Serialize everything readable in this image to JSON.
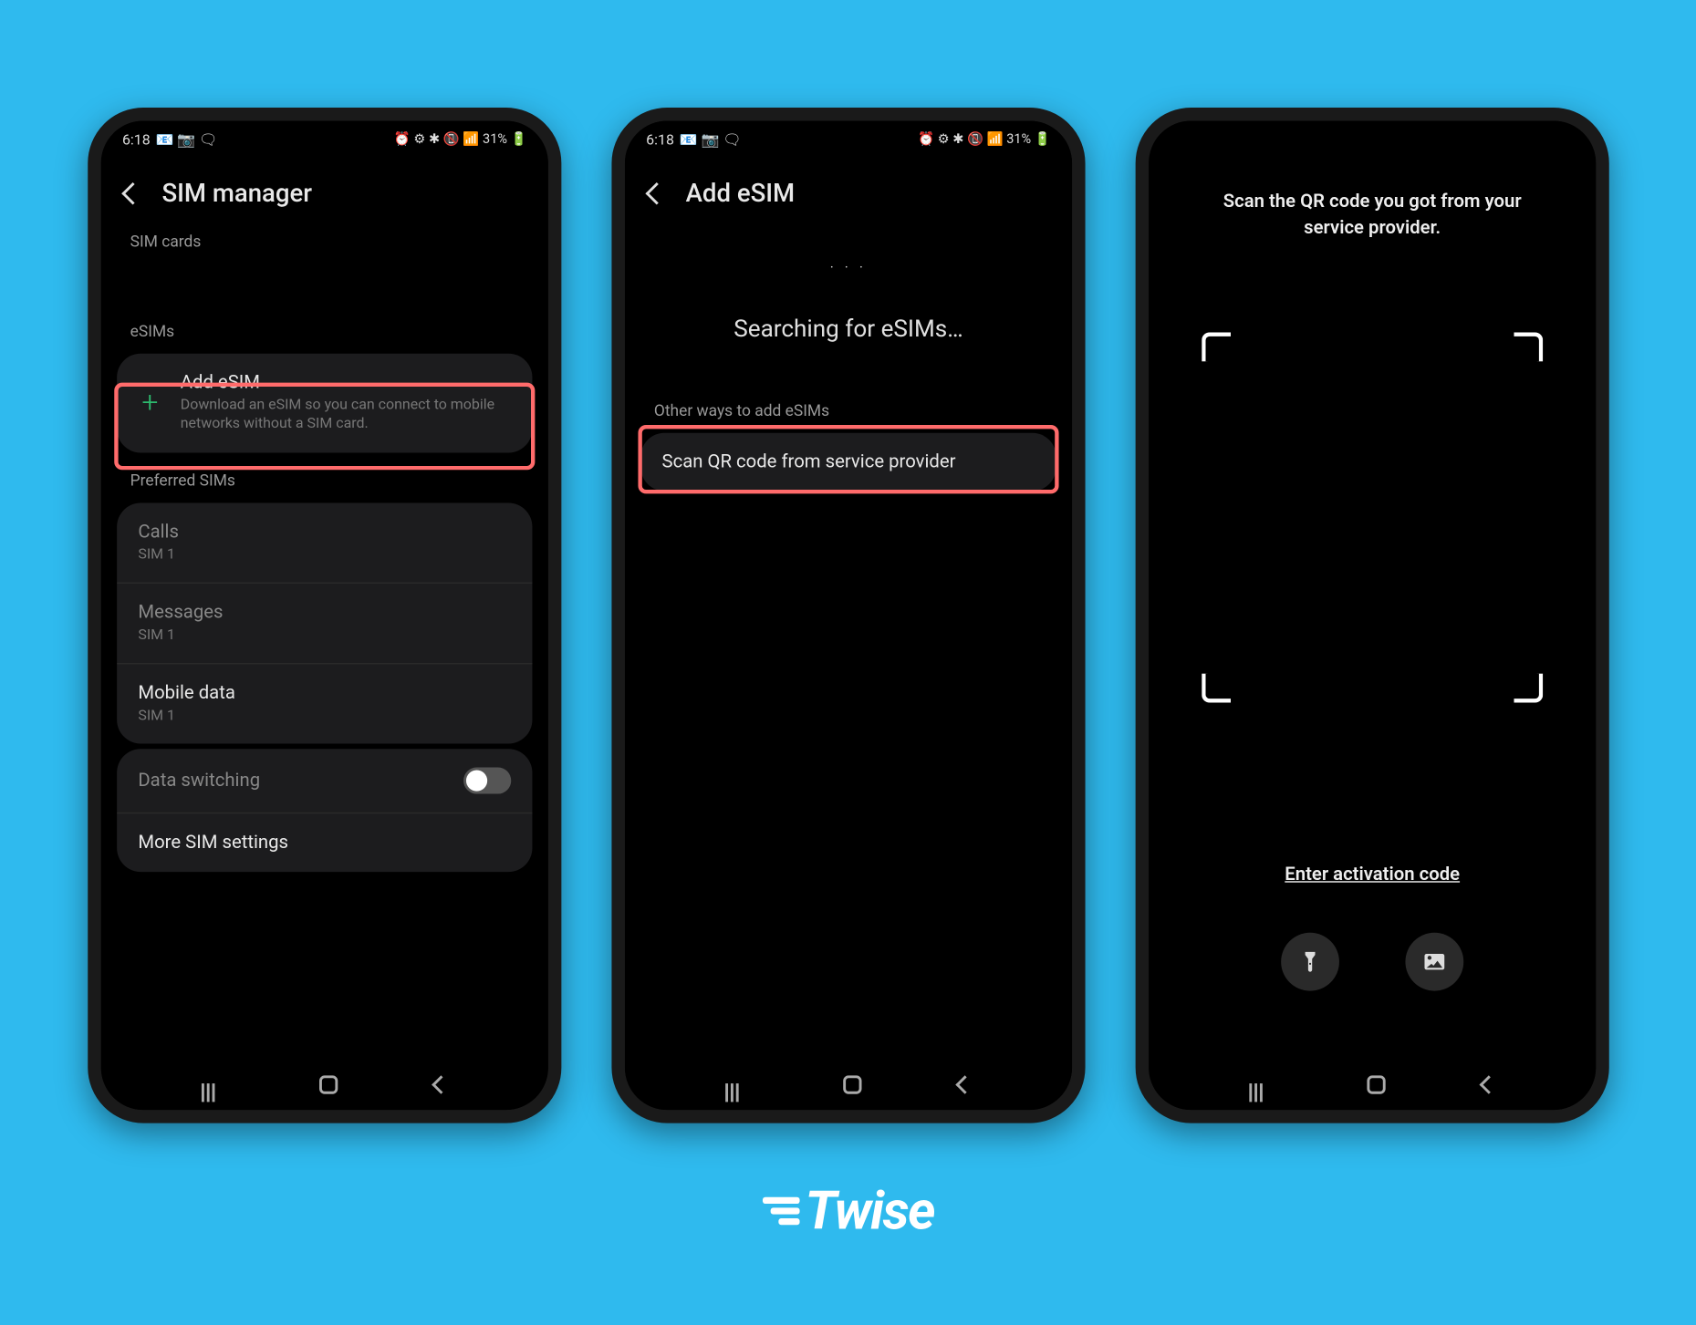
{
  "brand": "Twise",
  "colors": {
    "background": "#2fbaee",
    "highlight": "#ff6b6b",
    "accent": "#2dbb6e"
  },
  "statusbar": {
    "time": "6:18",
    "icons_left": "📧 📷 🗨",
    "icons_right": "⏰ ⚙ ✱ 📵 📶 31% 🔋"
  },
  "phone1": {
    "title": "SIM manager",
    "sections": {
      "sim_cards": "SIM cards",
      "esims": "eSIMs",
      "preferred": "Preferred SIMs"
    },
    "add_esim": {
      "title": "Add eSIM",
      "sub": "Download an eSIM so you can connect to mobile networks without a SIM card."
    },
    "calls": {
      "title": "Calls",
      "sub": "SIM 1"
    },
    "messages": {
      "title": "Messages",
      "sub": "SIM 1"
    },
    "mobile_data": {
      "title": "Mobile data",
      "sub": "SIM 1"
    },
    "data_switching": "Data switching",
    "more": "More SIM settings"
  },
  "phone2": {
    "title": "Add eSIM",
    "searching": "Searching for eSIMs…",
    "other_ways": "Other ways to add eSIMs",
    "scan_qr": "Scan QR code from service provider"
  },
  "phone3": {
    "instruction": "Scan the QR code you got from your service provider.",
    "activation_link": "Enter activation code",
    "icons": {
      "flash": "flashlight-icon",
      "gallery": "gallery-icon"
    }
  }
}
